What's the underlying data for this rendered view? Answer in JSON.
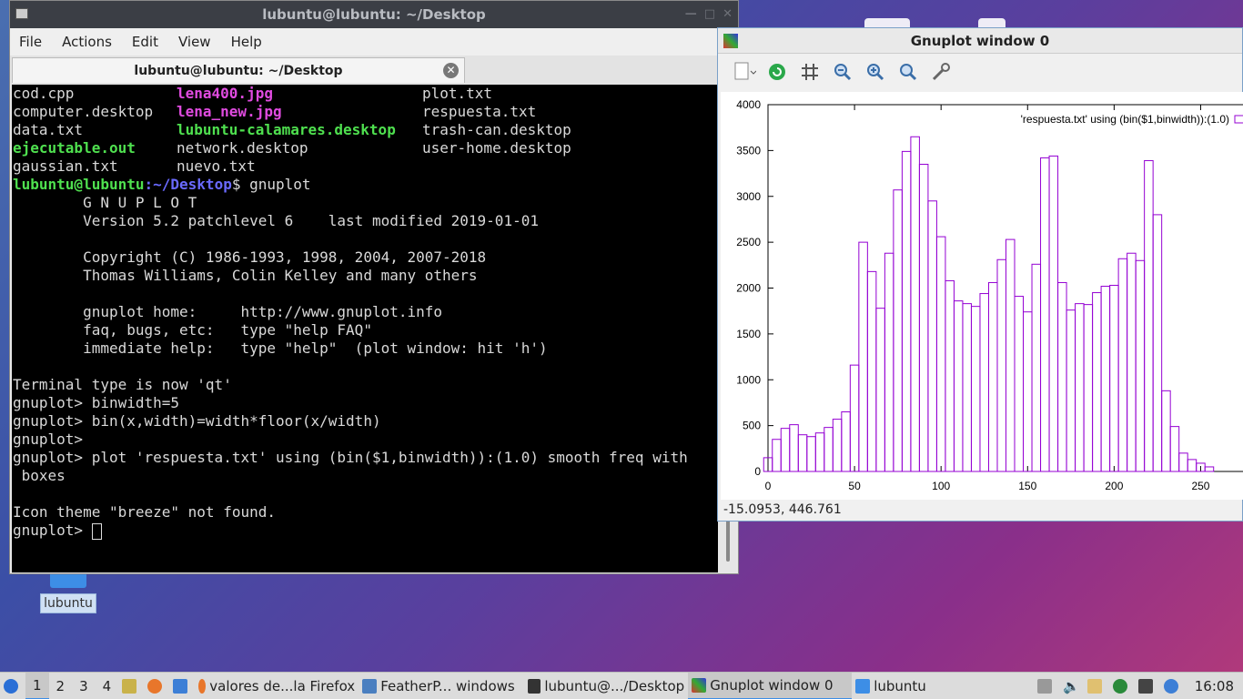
{
  "desktop": {
    "icon_label": "lubuntu"
  },
  "terminal": {
    "title": "lubuntu@lubuntu: ~/Desktop",
    "menu": [
      "File",
      "Actions",
      "Edit",
      "View",
      "Help"
    ],
    "tab_title": "lubuntu@lubuntu: ~/Desktop",
    "listing": [
      [
        "cod.cpp",
        "lena400.jpg",
        "plot.txt"
      ],
      [
        "computer.desktop",
        "lena_new.jpg",
        "respuesta.txt"
      ],
      [
        "data.txt",
        "lubuntu-calamares.desktop",
        "trash-can.desktop"
      ],
      [
        "ejecutable.out",
        "network.desktop",
        "user-home.desktop"
      ],
      [
        "gaussian.txt",
        "nuevo.txt",
        ""
      ]
    ],
    "prompt_user": "lubuntu@lubuntu",
    "prompt_path": ":~/Desktop",
    "prompt_cmd": "$ gnuplot",
    "lines": [
      "        G N U P L O T",
      "        Version 5.2 patchlevel 6    last modified 2019-01-01",
      "",
      "        Copyright (C) 1986-1993, 1998, 2004, 2007-2018",
      "        Thomas Williams, Colin Kelley and many others",
      "",
      "        gnuplot home:     http://www.gnuplot.info",
      "        faq, bugs, etc:   type \"help FAQ\"",
      "        immediate help:   type \"help\"  (plot window: hit 'h')",
      "",
      "Terminal type is now 'qt'",
      "gnuplot> binwidth=5",
      "gnuplot> bin(x,width)=width*floor(x/width)",
      "gnuplot> ",
      "gnuplot> plot 'respuesta.txt' using (bin($1,binwidth)):(1.0) smooth freq with",
      " boxes",
      "",
      "Icon theme \"breeze\" not found.",
      "gnuplot> "
    ]
  },
  "gnuplot": {
    "title": "Gnuplot window 0",
    "status": "-15.0953, 446.761",
    "toolbar_icons": [
      "export-icon",
      "replot-icon",
      "grid-icon",
      "zoom-out-icon",
      "zoom-in-icon",
      "zoom-fit-icon",
      "settings-icon"
    ]
  },
  "chart_data": {
    "type": "bar",
    "title": "",
    "legend": "'respuesta.txt' using (bin($1,binwidth)):(1.0)",
    "legend_position": "top-right",
    "color": "#9400d3",
    "bin_width": 5,
    "xlim": [
      0,
      275
    ],
    "ylim": [
      0,
      4000
    ],
    "x_ticks": [
      0,
      50,
      100,
      150,
      200,
      250
    ],
    "y_ticks": [
      0,
      500,
      1000,
      1500,
      2000,
      2500,
      3000,
      3500,
      4000
    ],
    "x": [
      0,
      5,
      10,
      15,
      20,
      25,
      30,
      35,
      40,
      45,
      50,
      55,
      60,
      65,
      70,
      75,
      80,
      85,
      90,
      95,
      100,
      105,
      110,
      115,
      120,
      125,
      130,
      135,
      140,
      145,
      150,
      155,
      160,
      165,
      170,
      175,
      180,
      185,
      190,
      195,
      200,
      205,
      210,
      215,
      220,
      225,
      230,
      235,
      240,
      245,
      250,
      255
    ],
    "values": [
      150,
      350,
      470,
      510,
      400,
      380,
      420,
      480,
      570,
      650,
      1160,
      2500,
      2180,
      1780,
      2380,
      3070,
      3490,
      3650,
      3350,
      2950,
      2560,
      2080,
      1860,
      1830,
      1800,
      1940,
      2060,
      2310,
      2530,
      1910,
      1740,
      2260,
      3420,
      3440,
      2060,
      1760,
      1830,
      1820,
      1950,
      2020,
      2030,
      2320,
      2380,
      2300,
      3390,
      2800,
      880,
      490,
      200,
      130,
      90,
      50
    ]
  },
  "taskbar": {
    "workspaces": [
      "1",
      "2",
      "3",
      "4"
    ],
    "tasks": [
      "valores de...la Firefox",
      "FeatherP... windows",
      "lubuntu@.../Desktop",
      "Gnuplot window 0",
      "lubuntu"
    ],
    "clock": "16:08"
  }
}
